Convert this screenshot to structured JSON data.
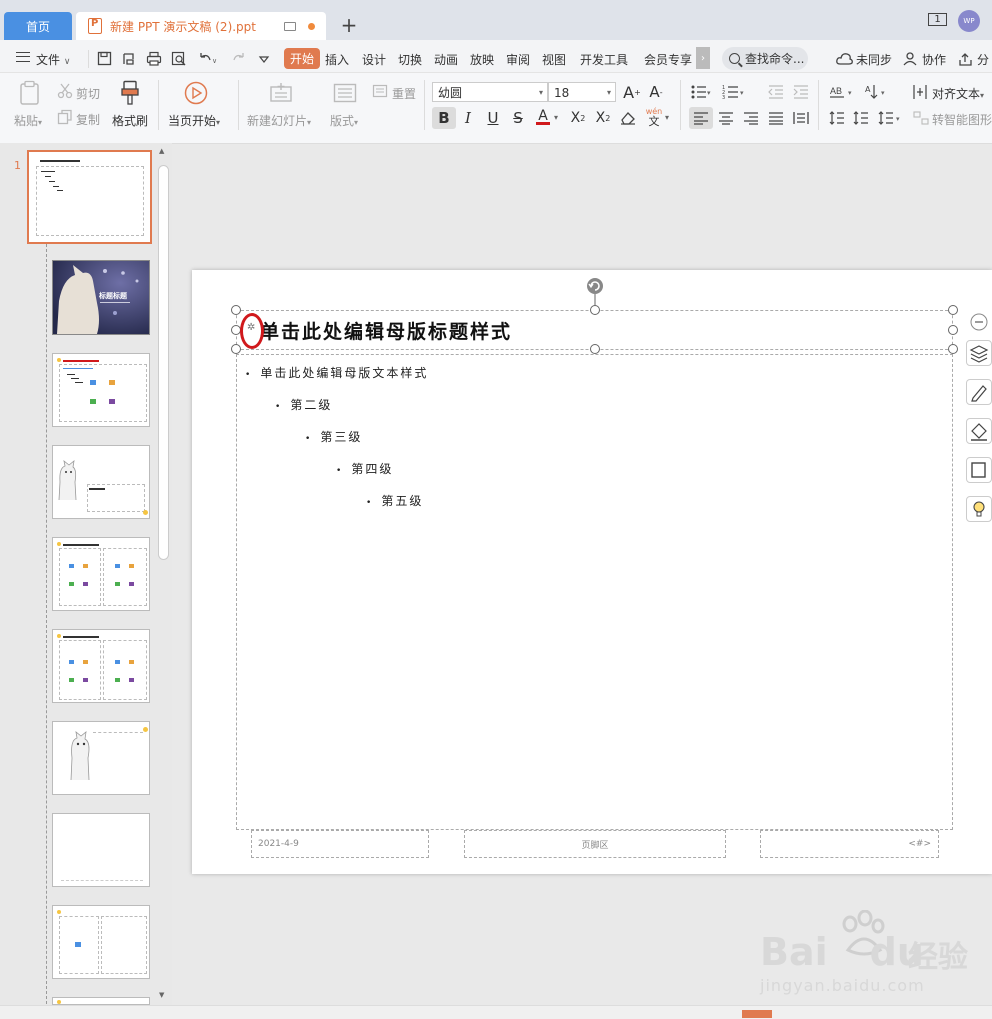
{
  "tabs": {
    "home": "首页",
    "document": "新建 PPT 演示文稿 (2).ppt",
    "window_count": "1",
    "avatar_text": "WP"
  },
  "menu": {
    "file": "文件",
    "items": [
      "开始",
      "插入",
      "设计",
      "切换",
      "动画",
      "放映",
      "审阅",
      "视图",
      "开发工具",
      "会员专享"
    ],
    "search": "查找命令...",
    "sync": "未同步",
    "collab": "协作",
    "share": "分"
  },
  "toolbar": {
    "paste": "粘贴",
    "cut": "剪切",
    "copy": "复制",
    "format_painter": "格式刷",
    "play_from_current": "当页开始",
    "new_slide": "新建幻灯片",
    "layout": "版式",
    "reset": "重置",
    "font_name": "幼圆",
    "font_size": "18",
    "align_text": "对齐文本",
    "smart_art": "转智能图形"
  },
  "slides": {
    "current_number": "1",
    "thumb2_title": "标题标题"
  },
  "slide": {
    "title": "单击此处编辑母版标题样式",
    "levels": [
      "单击此处编辑母版文本样式",
      "第二级",
      "第三级",
      "第四级",
      "第五级"
    ],
    "footer_date": "2021-4-9",
    "footer_text": "页脚区",
    "footer_number": "<#>"
  },
  "watermark": {
    "brand": "Bai",
    "brand2": "du",
    "cn": "经验",
    "url": "jingyan.baidu.com"
  },
  "colors": {
    "accent": "#e07a4f",
    "tab_blue": "#4a90e2",
    "annotation_red": "#d0191c"
  }
}
